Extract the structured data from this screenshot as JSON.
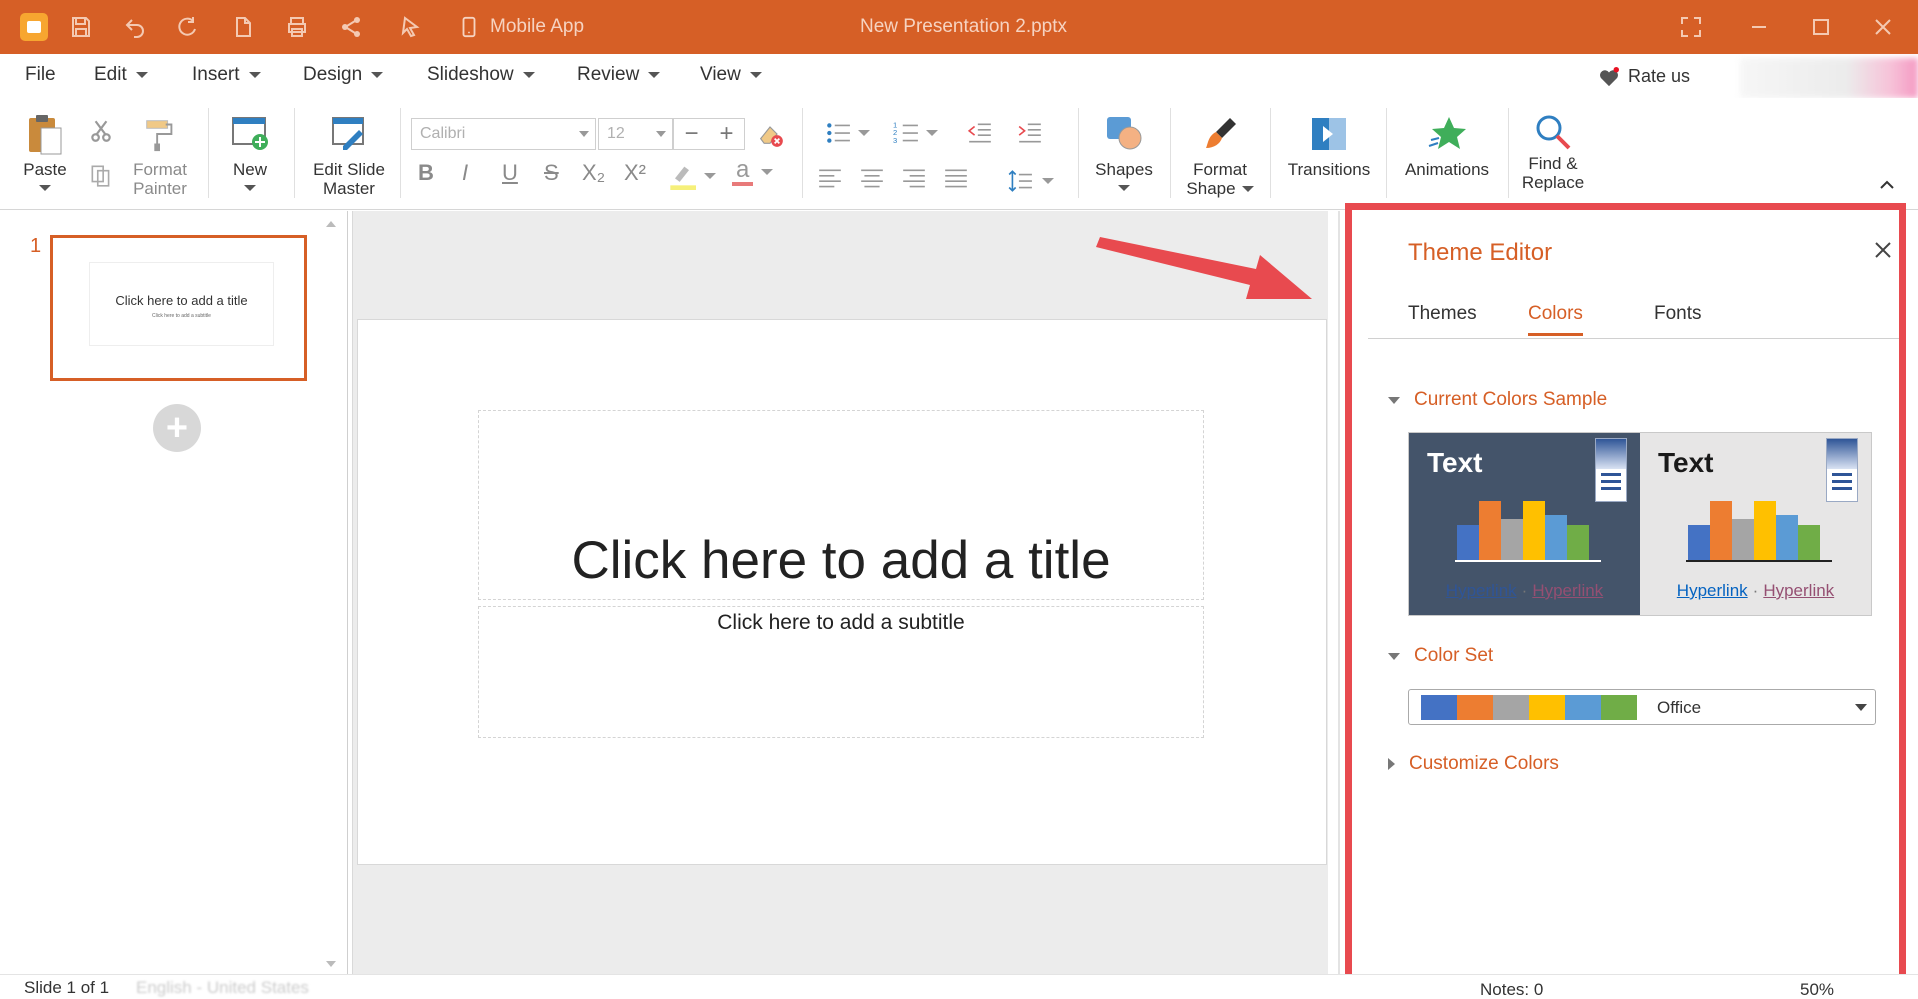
{
  "titlebar": {
    "doc_title": "New Presentation 2.pptx",
    "mobile_app_label": "Mobile App",
    "bg_color": "#d65f26"
  },
  "menu": {
    "items": [
      {
        "label": "File",
        "dropdown": false
      },
      {
        "label": "Edit",
        "dropdown": true
      },
      {
        "label": "Insert",
        "dropdown": true
      },
      {
        "label": "Design",
        "dropdown": true
      },
      {
        "label": "Slideshow",
        "dropdown": true
      },
      {
        "label": "Review",
        "dropdown": true
      },
      {
        "label": "View",
        "dropdown": true
      }
    ],
    "rate_us": "Rate us"
  },
  "ribbon": {
    "paste": "Paste",
    "format_painter_1": "Format",
    "format_painter_2": "Painter",
    "new": "New",
    "edit_slide_master_1": "Edit Slide",
    "edit_slide_master_2": "Master",
    "font_name": "Calibri",
    "font_size": "12",
    "shapes": "Shapes",
    "format_shape_1": "Format",
    "format_shape_2": "Shape",
    "transitions": "Transitions",
    "animations": "Animations",
    "find_replace_1": "Find &",
    "find_replace_2": "Replace",
    "fmt_bold": "B",
    "fmt_italic": "I",
    "fmt_underline": "U",
    "fmt_strike": "S",
    "fmt_sub": "X₂",
    "fmt_sup": "X²",
    "font_color_letter": "a"
  },
  "thumbnails": {
    "slide_number": "1",
    "thumb_title": "Click here to add a title",
    "thumb_subtitle": "Click here to add a subtitle"
  },
  "slide": {
    "title_placeholder": "Click here to add a title",
    "subtitle_placeholder": "Click here to add a subtitle"
  },
  "theme_editor": {
    "title": "Theme Editor",
    "tabs": [
      "Themes",
      "Colors",
      "Fonts"
    ],
    "active_tab": "Colors",
    "sections": {
      "current_colors_sample": "Current Colors Sample",
      "color_set": "Color Set",
      "customize_colors": "Customize Colors"
    },
    "sample_text": "Text",
    "hyperlink": "Hyperlink",
    "followed_hyperlink": "Hyperlink",
    "color_set_name": "Office",
    "palette": [
      "#4472c4",
      "#ed7d31",
      "#a5a5a5",
      "#ffc000",
      "#5b9bd5",
      "#70ad47"
    ],
    "accent_color": "#d65f26",
    "highlight_color": "#e84a4f"
  },
  "statusbar": {
    "slide_counter": "Slide 1 of 1",
    "language": "English - United States",
    "notes": "Notes: 0",
    "zoom": "50%"
  }
}
